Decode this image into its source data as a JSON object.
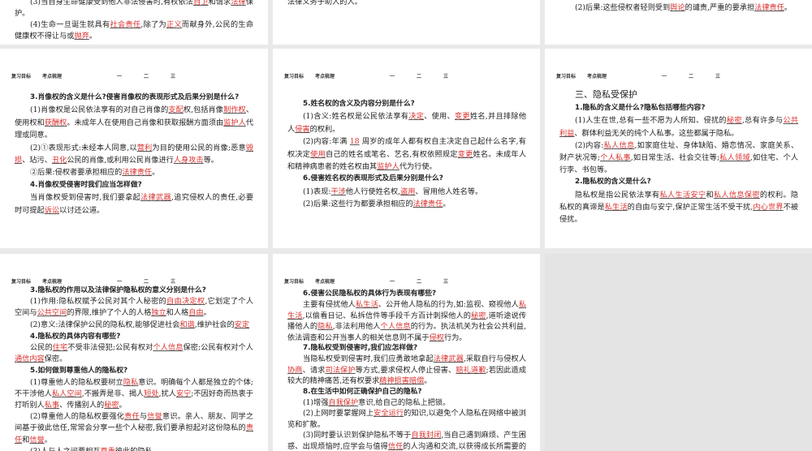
{
  "header": {
    "nav1": "复习目标",
    "nav2": "考点梳理",
    "tab1": "一",
    "tab2": "二",
    "tab3": "三"
  },
  "panels": [
    {
      "id": "top-left",
      "paras": [
        {
          "k": "p",
          "s": [
            "(3)当自身生命健康受到他人非法侵害时,有权依法",
            "自卫",
            "和请求",
            "法律",
            "保护。"
          ]
        },
        {
          "k": "p",
          "s": [
            "(4)生命一旦诞生就具有",
            "社会责任",
            ",除了为",
            "正义",
            "而献身外,公民的生命健康权不得让与或",
            "抛弃",
            "。"
          ]
        }
      ]
    },
    {
      "id": "top-middle",
      "paras": [
        {
          "k": "c",
          "s": [
            "法律义务于助人的人。"
          ]
        }
      ]
    },
    {
      "id": "top-right",
      "paras": [
        {
          "k": "p",
          "s": [
            "(2)后果:这些侵权者轻则受到",
            "舆论",
            "的谴责,严重的要承担",
            "法律责任",
            "。"
          ]
        }
      ]
    },
    {
      "id": "mid-left",
      "paras": [
        {
          "k": "q",
          "s": [
            "3.肖像权的含义是什么?侵害肖像权的表现形式及后果分别是什么?"
          ]
        },
        {
          "k": "p",
          "s": [
            "(1)肖像权是公民依法享有的对自己肖像的",
            "支配",
            "权,包括肖像",
            "制作权",
            "、使用权和",
            "获酬权",
            "。未成年人在使用自己肖像和获取报酬方面须由",
            "监护人",
            "代理或同意。"
          ]
        },
        {
          "k": "p",
          "s": [
            "(2)①表现形式:未经本人同意,以",
            "营利",
            "为目的使用公民的肖像;恶意",
            "毁损",
            "、玷污、",
            "丑化",
            "公民的肖像,或利用公民肖像进行",
            "人身攻击",
            "等。"
          ]
        },
        {
          "k": "p",
          "s": [
            "②后果:侵权者要承担相应的",
            "法律责任",
            "。"
          ]
        },
        {
          "k": "q",
          "s": [
            "4.肖像权受侵害时我们应当怎样做?"
          ]
        },
        {
          "k": "p",
          "s": [
            "当肖像权受到侵害时,我们要拿起",
            "法律武器",
            ",追究侵权人的责任,必要时可提起",
            "诉讼",
            "以讨还公道。"
          ]
        }
      ]
    },
    {
      "id": "mid-middle",
      "paras": [
        {
          "k": "q",
          "s": [
            "5.姓名权的含义及内容分别是什么?"
          ]
        },
        {
          "k": "p",
          "s": [
            "(1)含义:姓名权是公民依法享有",
            "决定",
            "、使用、",
            "变更",
            "姓名,并且排除他人",
            "侵害",
            "的权利。"
          ]
        },
        {
          "k": "p",
          "s": [
            "(2)内容:年满 ",
            "18",
            " 周岁的成年人都有权自主决定自己起什么名字,有权决定",
            "使用",
            "自己的姓名或笔名、艺名,有权依照规定",
            "变更",
            "姓名。未成年人和精神病患者的姓名权由其",
            "监护人",
            "代为行使。"
          ]
        },
        {
          "k": "q",
          "s": [
            "6.侵害姓名权的表现形式及后果分别是什么?"
          ]
        },
        {
          "k": "p",
          "s": [
            "(1)表现:",
            "干涉",
            "他人行使姓名权,",
            "盗用",
            "、冒用他人姓名等。"
          ]
        },
        {
          "k": "p",
          "s": [
            "(2)后果:这些行为都要承担相应的",
            "法律责任",
            "。"
          ]
        }
      ]
    },
    {
      "id": "mid-right",
      "paras": [
        {
          "k": "t",
          "s": [
            "三、隐私受保护"
          ]
        },
        {
          "k": "q",
          "s": [
            "1.隐私的含义是什么?隐私包括哪些内容?"
          ]
        },
        {
          "k": "p",
          "s": [
            "(1)人生在世,总有一些不愿为人所知、侵扰的",
            "秘密",
            ",总有许多与",
            "公共利益",
            "、群体利益无关的纯个人私事。这些都属于隐私。"
          ]
        },
        {
          "k": "p",
          "s": [
            "(2)内容:",
            "私人信息",
            ",如家庭住址、身体缺陷、婚恋情况、家庭关系、财产状况等;",
            "个人私事",
            ",如日常生活、社会交往等;",
            "私人领域",
            ",如住宅、个人行李、书包等。"
          ]
        },
        {
          "k": "q",
          "s": [
            "2.隐私权的含义是什么?"
          ]
        },
        {
          "k": "p",
          "s": [
            "隐私权是指公民依法享有",
            "私人生活安宁",
            "和",
            "私人信息保密",
            "的权利。隐私权的真谛是",
            "私生活",
            "的自由与安宁,保护正常生活不受干扰,",
            "内心世界",
            "不被侵扰。"
          ]
        }
      ]
    },
    {
      "id": "bot-left",
      "paras": [
        {
          "k": "q",
          "s": [
            "3.隐私权的作用以及法律保护隐私权的意义分别是什么?"
          ]
        },
        {
          "k": "p",
          "s": [
            "(1)作用:隐私权赋予公民对其个人秘密的",
            "自由决定权",
            ",它划定了个人空间与",
            "公共空间",
            "的界限,维护了个人的人格",
            "独立",
            "和人格",
            "自由",
            "。"
          ]
        },
        {
          "k": "p",
          "s": [
            "(2)意义:法律保护公民的隐私权,能够促进社会",
            "和谐",
            ",维护社会的",
            "安定"
          ]
        },
        {
          "k": "q",
          "s": [
            "4.隐私权的具体内容有哪些?"
          ]
        },
        {
          "k": "p",
          "s": [
            "公民的",
            "住宅",
            "不受非法侵犯;公民有权对",
            "个人信息",
            "保密;公民有权对个人",
            "通信内容",
            "保密。"
          ]
        },
        {
          "k": "q",
          "s": [
            "5.如何做到尊重他人的隐私权?"
          ]
        },
        {
          "k": "p",
          "s": [
            "(1)尊重他人的隐私权要树立",
            "隐私",
            "意识。明确每个人都是独立的个体;不干涉他人",
            "私人空间",
            ",不搬弄是非、揭人",
            "短处",
            ",扰人",
            "安宁",
            ";不因好奇而热衷于打听别人",
            "私事",
            "、传播别人的",
            "秘密",
            "。"
          ]
        },
        {
          "k": "p",
          "s": [
            "(2)尊重他人的隐私权要强化",
            "责任",
            "与",
            "信誉",
            "意识。亲人、朋友、同学之间基于彼此信任,常常会分享一些个人秘密,我们要承担起对这份隐私的",
            "责任",
            "和",
            "信誉",
            "。"
          ]
        },
        {
          "k": "p",
          "s": [
            "(3)人与人之间要相互",
            "尊重",
            "彼此的隐私。"
          ]
        }
      ]
    },
    {
      "id": "bot-middle",
      "paras": [
        {
          "k": "q",
          "s": [
            "6.侵害公民隐私权的具体行为表现有哪些?"
          ]
        },
        {
          "k": "p",
          "s": [
            "主要有侵扰他人",
            "私生活",
            "、公开他人隐私的行为,如:监视、窥视他人",
            "私生活",
            ",以偷看日记、私拆信件等手段千方百计刺探他人的",
            "秘密",
            ",道听途说传播他人的",
            "隐私",
            ",非法利用他人",
            "个人信息",
            "的行为。执法机关为社会公共利益,依法调查和公开当事人的相关信息则不属于",
            "侵权",
            "行为。"
          ]
        },
        {
          "k": "q",
          "s": [
            "7.隐私权受到侵害时,我们应怎样做?"
          ]
        },
        {
          "k": "p",
          "s": [
            "当隐私权受到侵害时,我们应勇敢地拿起",
            "法律武器",
            ",采取自行与侵权人",
            "协商",
            "、请求",
            "司法保护",
            "等方式,要求侵权人停止侵害、",
            "赔礼道歉",
            ";若因此造成较大的精神痛苦,还有权要求",
            "精神损害赔偿",
            "。"
          ]
        },
        {
          "k": "q",
          "s": [
            "8.在生活中如何正确保护自己的隐私?"
          ]
        },
        {
          "k": "p",
          "s": [
            "(1)增强",
            "自我保护",
            "意识,给自己的隐私上把锁。"
          ]
        },
        {
          "k": "p",
          "s": [
            "(2)上网时要掌握网上",
            "安全运行",
            "的知识,以避免个人隐私在网络中被浏览和扩散。"
          ]
        },
        {
          "k": "p",
          "s": [
            "(3)同时要认识到保护隐私不等于",
            "自我封闭",
            ",当自己遇到麻烦、产生困惑、出现烦恼时,应学会与值得",
            "信任",
            "的人沟通和交流,以获得成长所需要的理解和帮助。"
          ]
        }
      ]
    }
  ]
}
